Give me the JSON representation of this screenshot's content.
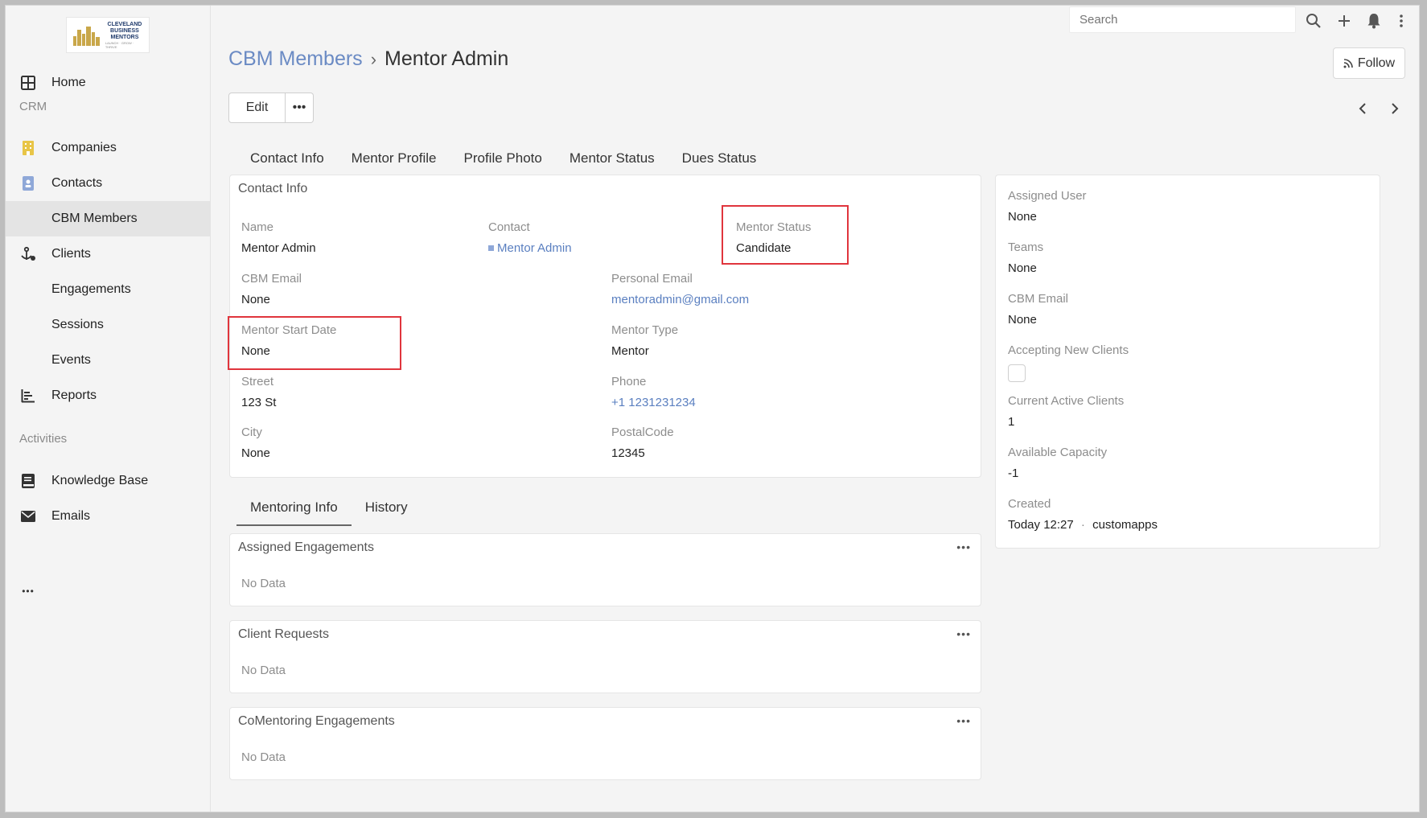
{
  "logo": {
    "line1": "CLEVELAND",
    "line2": "BUSINESS",
    "line3": "MENTORS",
    "tagline": "LAUNCH · GROW · THRIVE"
  },
  "sidebar": {
    "home": "Home",
    "section_crm": "CRM",
    "companies": "Companies",
    "contacts": "Contacts",
    "cbm_members": "CBM Members",
    "clients": "Clients",
    "engagements": "Engagements",
    "sessions": "Sessions",
    "events": "Events",
    "reports": "Reports",
    "section_activities": "Activities",
    "knowledge_base": "Knowledge Base",
    "emails": "Emails",
    "more": "•••"
  },
  "topbar": {
    "search_placeholder": "Search"
  },
  "header": {
    "breadcrumb_parent": "CBM Members",
    "breadcrumb_sep": "›",
    "breadcrumb_current": "Mentor Admin",
    "follow_label": "Follow",
    "edit_label": "Edit",
    "more_label": "•••"
  },
  "tabs_top": [
    "Contact Info",
    "Mentor Profile",
    "Profile Photo",
    "Mentor Status",
    "Dues Status"
  ],
  "contact_info": {
    "title": "Contact Info",
    "name_label": "Name",
    "name_value": "Mentor Admin",
    "contact_label": "Contact",
    "contact_value": "Mentor Admin",
    "mentor_status_label": "Mentor Status",
    "mentor_status_value": "Candidate",
    "cbm_email_label": "CBM Email",
    "cbm_email_value": "None",
    "personal_email_label": "Personal Email",
    "personal_email_value": "mentoradmin@gmail.com",
    "start_date_label": "Mentor Start Date",
    "start_date_value": "None",
    "mentor_type_label": "Mentor Type",
    "mentor_type_value": "Mentor",
    "street_label": "Street",
    "street_value": "123 St",
    "phone_label": "Phone",
    "phone_value": "+1 1231231234",
    "city_label": "City",
    "city_value": "None",
    "postal_label": "PostalCode",
    "postal_value": "12345"
  },
  "tabs_bottom": [
    "Mentoring Info",
    "History"
  ],
  "panels": {
    "assigned_engagements": {
      "title": "Assigned Engagements",
      "empty": "No Data",
      "dots": "•••"
    },
    "client_requests": {
      "title": "Client Requests",
      "empty": "No Data",
      "dots": "•••"
    },
    "comentoring": {
      "title": "CoMentoring Engagements",
      "empty": "No Data",
      "dots": "•••"
    }
  },
  "side_panel": {
    "assigned_user_label": "Assigned User",
    "assigned_user_value": "None",
    "teams_label": "Teams",
    "teams_value": "None",
    "cbm_email_label": "CBM Email",
    "cbm_email_value": "None",
    "accepting_label": "Accepting New Clients",
    "accepting_checked": false,
    "active_clients_label": "Current Active Clients",
    "active_clients_value": "1",
    "capacity_label": "Available Capacity",
    "capacity_value": "-1",
    "created_label": "Created",
    "created_value": "Today 12:27",
    "created_dot": "·",
    "created_by": "customapps"
  },
  "colors": {
    "link": "#6b8bc4",
    "highlight": "#e0353d",
    "companies_icon": "#e8c547",
    "contacts_icon": "#8fa8d8"
  }
}
